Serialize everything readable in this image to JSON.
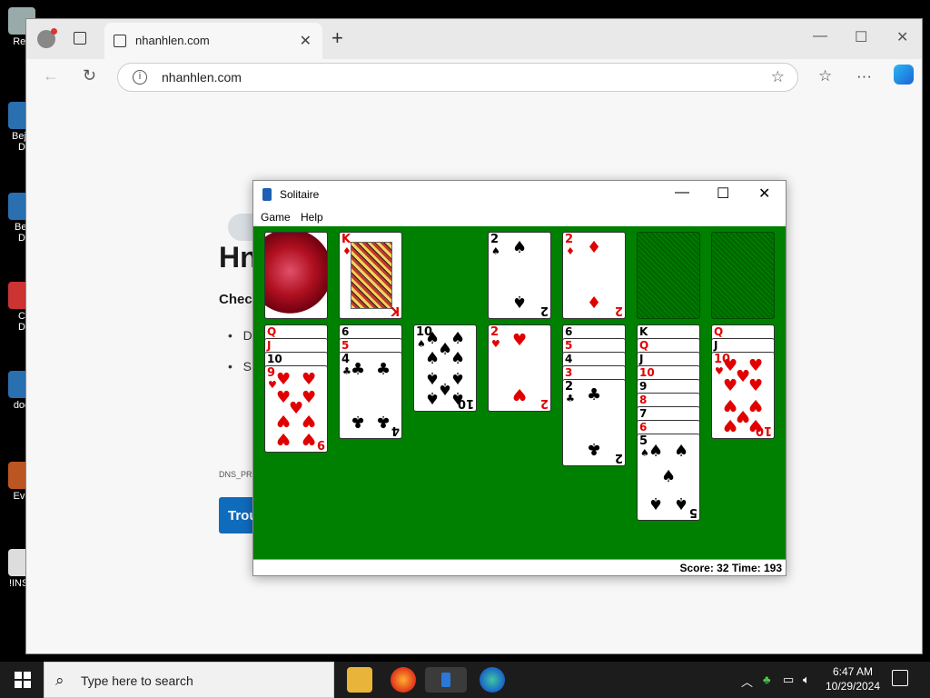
{
  "desktop": {
    "icons": [
      {
        "label": "Rec"
      },
      {
        "label": "Beje\nD"
      },
      {
        "label": "Bej\nD"
      },
      {
        "label": "C\nD"
      },
      {
        "label": "doe"
      },
      {
        "label": "Eve"
      },
      {
        "label": "!INST"
      }
    ]
  },
  "browser": {
    "tab_title": "nhanhlen.com",
    "tab_close": "✕",
    "new_tab": "+",
    "url": "nhanhlen.com",
    "window_controls": {
      "minimize": "—",
      "maximize": "☐",
      "close": "✕"
    },
    "page": {
      "title": "Hn",
      "subtitle": "Check",
      "list": [
        "D",
        "S"
      ],
      "code": "DNS_PR",
      "button": "Trou"
    }
  },
  "solitaire": {
    "title": "Solitaire",
    "menu": [
      "Game",
      "Help"
    ],
    "window_controls": {
      "minimize": "—",
      "maximize": "☐",
      "close": "✕"
    },
    "status": "Score: 32 Time: 193",
    "stock_waste": {
      "waste_rank": "K",
      "waste_suit": "♦"
    },
    "foundations": [
      {
        "rank": "2",
        "suit": "♠",
        "color": "black"
      },
      {
        "rank": "2",
        "suit": "♦",
        "color": "red"
      },
      {
        "empty": true
      },
      {
        "empty": true
      }
    ],
    "tableau": [
      {
        "stubs": [
          {
            "r": "Q",
            "c": "red"
          },
          {
            "r": "J",
            "c": "red"
          },
          {
            "r": "10",
            "c": "blk"
          }
        ],
        "top": {
          "rank": "9",
          "suit": "♥",
          "color": "red"
        }
      },
      {
        "stubs": [
          {
            "r": "6",
            "c": "blk"
          },
          {
            "r": "5",
            "c": "red"
          }
        ],
        "top": {
          "rank": "4",
          "suit": "♣",
          "color": "black"
        }
      },
      {
        "stubs": [],
        "top": {
          "rank": "10",
          "suit": "♠",
          "color": "black"
        }
      },
      {
        "stubs": [],
        "top": {
          "rank": "2",
          "suit": "♥",
          "color": "red"
        }
      },
      {
        "stubs": [
          {
            "r": "6",
            "c": "blk"
          },
          {
            "r": "5",
            "c": "red"
          },
          {
            "r": "4",
            "c": "blk"
          },
          {
            "r": "3",
            "c": "red"
          }
        ],
        "top": {
          "rank": "2",
          "suit": "♣",
          "color": "black"
        }
      },
      {
        "stubs": [
          {
            "r": "K",
            "c": "blk"
          },
          {
            "r": "Q",
            "c": "red"
          },
          {
            "r": "J",
            "c": "blk"
          },
          {
            "r": "10",
            "c": "red"
          },
          {
            "r": "9",
            "c": "blk"
          },
          {
            "r": "8",
            "c": "red"
          },
          {
            "r": "7",
            "c": "blk"
          },
          {
            "r": "6",
            "c": "red"
          }
        ],
        "top": {
          "rank": "5",
          "suit": "♠",
          "color": "black"
        }
      },
      {
        "stubs": [
          {
            "r": "Q",
            "c": "red"
          },
          {
            "r": "J",
            "c": "blk"
          }
        ],
        "top": {
          "rank": "10",
          "suit": "♥",
          "color": "red"
        }
      }
    ]
  },
  "taskbar": {
    "search_placeholder": "Type here to search",
    "time": "6:47 AM",
    "date": "10/29/2024"
  }
}
